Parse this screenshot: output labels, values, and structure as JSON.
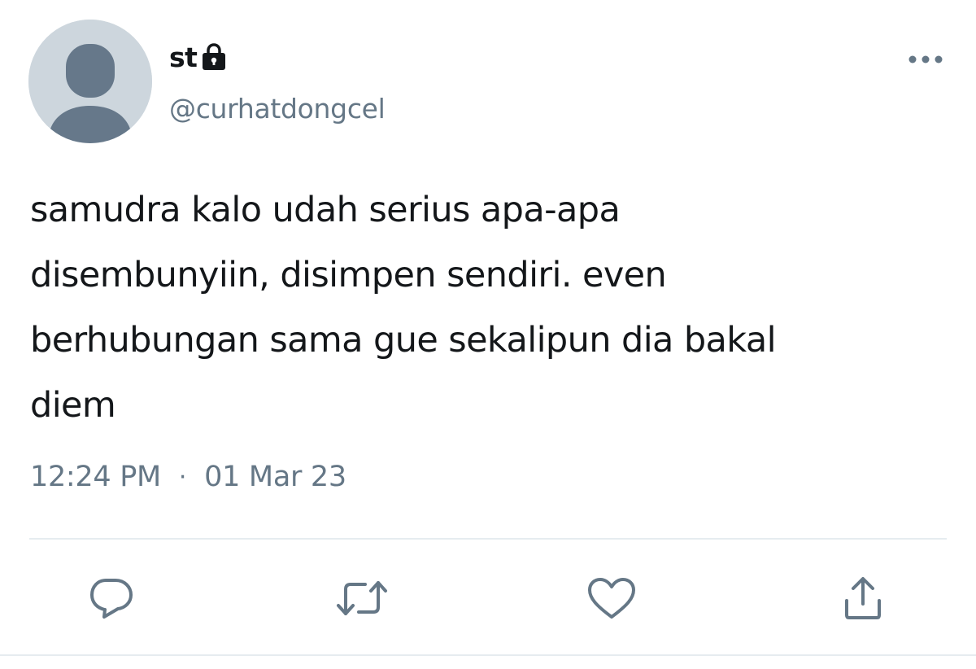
{
  "author": {
    "display_name": "st",
    "handle": "@curhatdongcel",
    "protected_icon": "lock-icon",
    "avatar": "default-avatar"
  },
  "tweet": {
    "text": "samudra kalo udah serius apa-apa\ndisembunyiin, disimpen sendiri. even\nberhubungan sama gue sekalipun dia bakal\ndiem",
    "time": "12:24 PM",
    "separator": "·",
    "date": "01 Mar 23"
  },
  "actions": [
    {
      "name": "reply",
      "icon": "reply-icon"
    },
    {
      "name": "retweet",
      "icon": "retweet-icon"
    },
    {
      "name": "like",
      "icon": "heart-icon"
    },
    {
      "name": "share",
      "icon": "share-icon"
    }
  ],
  "menu": {
    "icon": "more-icon"
  },
  "colors": {
    "text": "#14171a",
    "secondary": "#657786",
    "avatar_bg": "#cdd6dd",
    "avatar_fg": "#66788a",
    "divider": "#e6ecf0"
  }
}
